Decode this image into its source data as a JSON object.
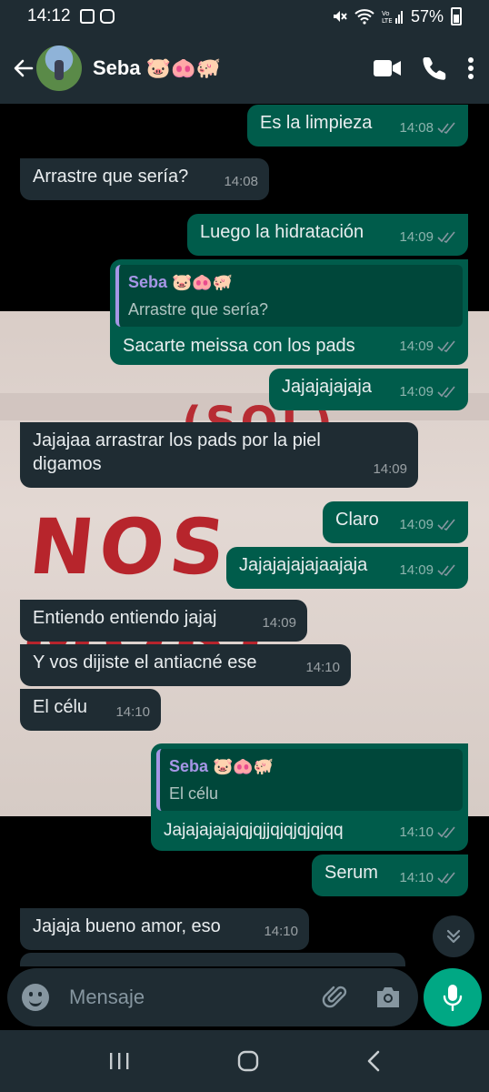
{
  "status_bar": {
    "time": "14:12",
    "battery": "57%"
  },
  "header": {
    "contact_name": "Seba 🐷🐽🐖"
  },
  "messages": [
    {
      "dir": "out",
      "text": "Es la limpieza",
      "time": "14:08"
    },
    {
      "dir": "in",
      "text": "Arrastre que sería?",
      "time": "14:08"
    },
    {
      "dir": "out",
      "text": "Luego la hidratación",
      "time": "14:09"
    },
    {
      "dir": "out",
      "quote_name": "Seba 🐷🐽🐖",
      "quote_text": "Arrastre que sería?",
      "text": "Sacarte meissa con los pads",
      "time": "14:09"
    },
    {
      "dir": "out",
      "text": "Jajajajajaja",
      "time": "14:09"
    },
    {
      "dir": "in",
      "text": "Jajajaa arrastrar los pads por la piel digamos",
      "time": "14:09"
    },
    {
      "dir": "out",
      "text": "Claro",
      "time": "14:09"
    },
    {
      "dir": "out",
      "text": "Jajajajajajaajaja",
      "time": "14:09"
    },
    {
      "dir": "in",
      "text": "Entiendo entiendo jajaj",
      "time": "14:09"
    },
    {
      "dir": "in",
      "text": "Y vos dijiste el antiacné ese",
      "time": "14:10"
    },
    {
      "dir": "in",
      "text": "El célu",
      "time": "14:10"
    },
    {
      "dir": "out",
      "quote_name": "Seba 🐷🐽🐖",
      "quote_text": "El célu",
      "text": "Jajajajajajqjqjjqjqjqjqjqq",
      "time": "14:10"
    },
    {
      "dir": "out",
      "text": "Serum",
      "time": "14:10"
    },
    {
      "dir": "in",
      "text": "Jajaja bueno amor, eso",
      "time": "14:10"
    }
  ],
  "wallpaper_text": {
    "top": "(SOL) ",
    "main": "NOS MORI"
  },
  "input": {
    "placeholder": "Mensaje"
  },
  "colors": {
    "incoming": "#1f2c33",
    "outgoing": "#005c4b",
    "accent": "#00a884",
    "quote_bar": "#a696e6"
  }
}
